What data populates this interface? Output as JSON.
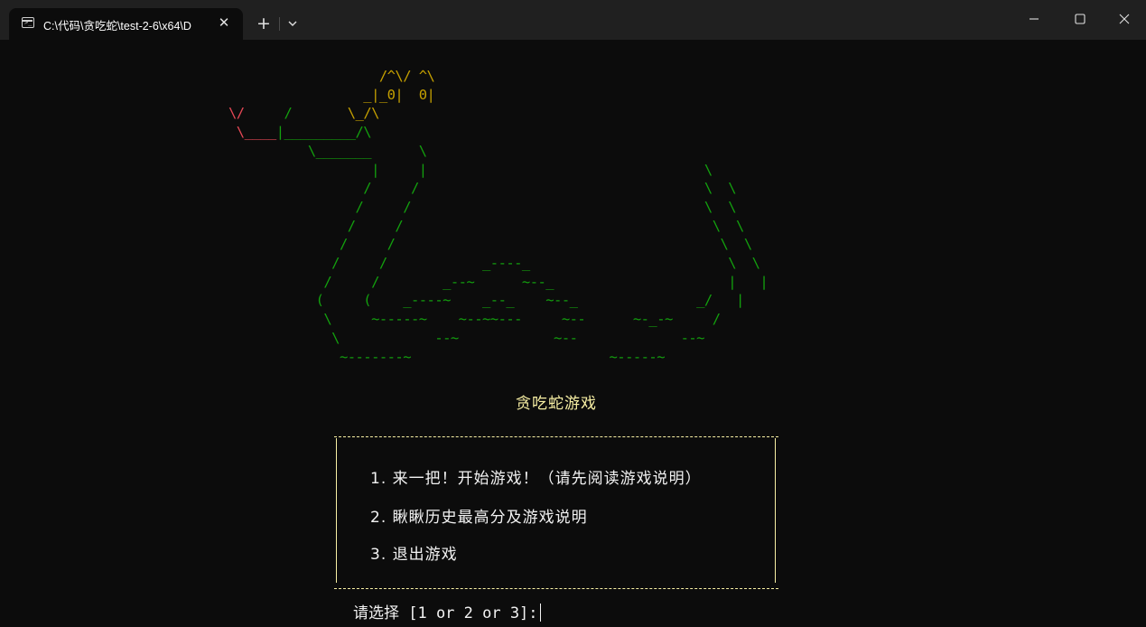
{
  "window": {
    "tab_title": "C:\\代码\\贪吃蛇\\test-2-6\\x64\\D",
    "tab_close_symbol": "✕",
    "new_tab_symbol": "+"
  },
  "ascii_art": {
    "head_top": "                   /^\\/ ^\\\n                 _|_0|  0|",
    "tongue_1": "\\/     ",
    "neck_1": "/       ",
    "mouth_1": "\\_/\\",
    "tongue_2": " \\____",
    "neck_2": "|_________/\\",
    "body": "          \\_______      \\\n                  |     |                                   \\\n                 /     /                                    \\  \\\n                /     /                                     \\  \\\n               /     /                                       \\  \\\n              /     /                                         \\  \\\n             /     /            _----_                         \\  \\\n            /     /        _--~      ~--_                      |   |\n           (     (    _----~    _--_    ~--_               _/   |\n            \\     ~-----~    ~--~~---     ~--      ~-_-~     /\n             \\            --~            ~--             --~\n              ~-------~                         ~-----~"
  },
  "game": {
    "title": "贪吃蛇游戏",
    "menu": [
      "1. 来一把！开始游戏！（请先阅读游戏说明）",
      "2. 瞅瞅历史最高分及游戏说明",
      "3. 退出游戏"
    ],
    "prompt": "请选择 [1 or 2 or 3]:"
  },
  "colors": {
    "background": "#0c0c0c",
    "titlebar": "#202020",
    "head": "#c5a000",
    "tongue": "#e74856",
    "body": "#13a10e",
    "frame": "#f9f1a5",
    "text": "#f2f2f2"
  }
}
